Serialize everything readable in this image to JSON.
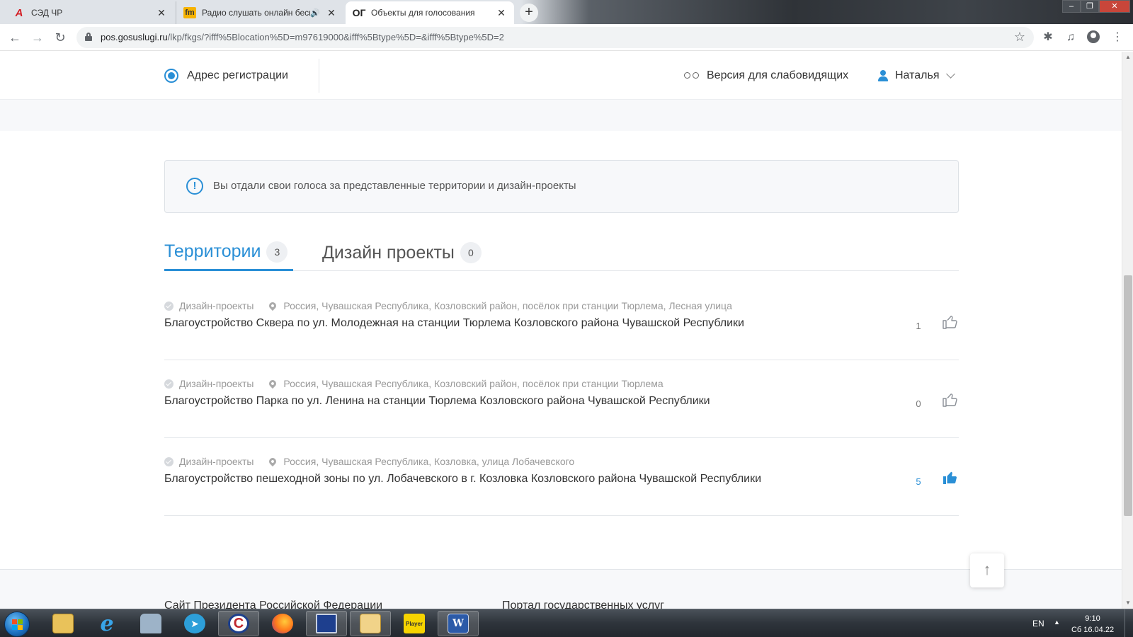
{
  "browser": {
    "tabs": [
      {
        "favicon": "red-italic-logo",
        "title": "СЭД ЧР"
      },
      {
        "favicon": "fm-logo",
        "title": "Радио слушать онлайн бесп"
      },
      {
        "favicon": "og-logo",
        "favicon_text": "ОГ",
        "title": "Объекты для голосования"
      }
    ],
    "url_host": "pos.gosuslugi.ru",
    "url_path": "/lkp/fkgs/?ifff%5Blocation%5D=m97619000&ifff%5Btype%5D=&ifff%5Btype%5D=2"
  },
  "header": {
    "address_label": "Адрес регистрации",
    "low_vision_label": "Версия для слабовидящих",
    "user_name": "Наталья"
  },
  "notice": {
    "text": "Вы отдали свои голоса за представленные территории и дизайн-проекты"
  },
  "tabs": [
    {
      "label": "Территории",
      "count": "3",
      "active": true
    },
    {
      "label": "Дизайн проекты",
      "count": "0",
      "active": false
    }
  ],
  "items": [
    {
      "category": "Дизайн-проекты",
      "address": "Россия, Чувашская Республика, Козловский район, посёлок при станции Тюрлема, Лесная улица",
      "title": "Благоустройство Сквера по ул. Молодежная на станции Тюрлема Козловского района Чувашской Республики",
      "votes": "1",
      "liked": false
    },
    {
      "category": "Дизайн-проекты",
      "address": "Россия, Чувашская Республика, Козловский район, посёлок при станции Тюрлема",
      "title": "Благоустройство Парка по ул. Ленина на станции Тюрлема Козловского района Чувашской Республики",
      "votes": "0",
      "liked": false
    },
    {
      "category": "Дизайн-проекты",
      "address": "Россия, Чувашская Республика, Козловка, улица Лобачевского",
      "title": "Благоустройство пешеходной зоны по ул. Лобачевского в г. Козловка Козловского района Чувашской Республики",
      "votes": "5",
      "liked": true
    }
  ],
  "footer": {
    "links": [
      "Сайт Президента Российской Федерации",
      "Портал государственных услуг"
    ]
  },
  "taskbar": {
    "player_label": "Player",
    "word_label": "W",
    "language": "EN",
    "time": "9:10",
    "date": "Сб 16.04.22"
  },
  "colors": {
    "accent": "#2a8fd6",
    "text": "#333333",
    "muted": "#999999"
  }
}
